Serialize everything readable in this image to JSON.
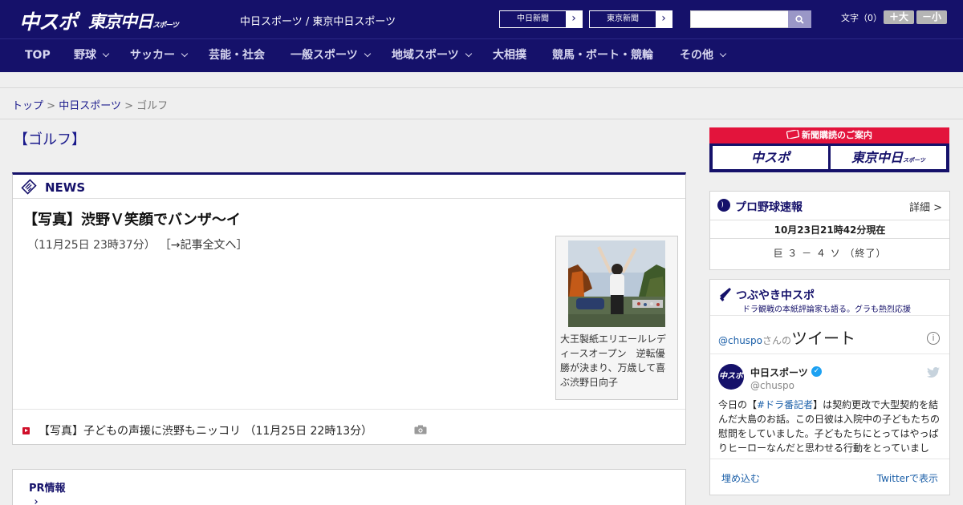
{
  "header": {
    "logo_chuspo": "中スポ",
    "logo_tokyo": "東京中日",
    "logo_tokyo_suffix": "スポーツ",
    "site_names": "中日スポーツ / 東京中日スポーツ",
    "paper_buttons": [
      "中日新聞",
      "東京新聞"
    ],
    "search_placeholder": "",
    "font_size_label": "文字（0）",
    "font_larger": "＋大",
    "font_smaller": "－小"
  },
  "nav": {
    "items": [
      {
        "label": "TOP",
        "has_dropdown": false
      },
      {
        "label": "野球",
        "has_dropdown": true
      },
      {
        "label": "サッカー",
        "has_dropdown": true
      },
      {
        "label": "芸能・社会",
        "has_dropdown": false
      },
      {
        "label": "一般スポーツ",
        "has_dropdown": true
      },
      {
        "label": "地域スポーツ",
        "has_dropdown": true
      },
      {
        "label": "大相撲",
        "has_dropdown": false
      },
      {
        "label": "競馬・ボート・競輪",
        "has_dropdown": false
      },
      {
        "label": "その他",
        "has_dropdown": true
      }
    ]
  },
  "breadcrumb": {
    "items": [
      "トップ",
      "中日スポーツ",
      "ゴルフ"
    ],
    "separator": ">"
  },
  "page": {
    "title": "【ゴルフ】"
  },
  "news": {
    "section_label": "NEWS",
    "headline": "【写真】渋野Ｖ笑顔でバンザ～イ",
    "date": "（11月25日 23時37分）",
    "full_article_link": "［→記事全文へ］",
    "photo_caption": "大王製紙エリエールレディースオープン　逆転優勝が決まり、万歳して喜ぶ渋野日向子",
    "related": "【写真】子どもの声援に渋野もニッコリ （11月25日 22時13分）"
  },
  "pr": {
    "label": "PR情報"
  },
  "sidebar": {
    "subscription_banner": {
      "title": "新聞購読のご案内",
      "left_button": "中スポ",
      "right_button": "東京中日",
      "right_button_suffix": "スポーツ"
    },
    "baseball": {
      "title": "プロ野球速報",
      "detail_link": "詳細 >",
      "updated": "10月23日21時42分現在",
      "score": "巨 ３ － ４ ソ （終了）"
    },
    "tweets": {
      "title": "つぶやき中スポ",
      "subtitle": "ドラ観戦の本紙評論家も語る。グラも熱烈応援",
      "handle": "@chuspo",
      "handle_suffix": "さんの",
      "heading": "ツイート",
      "account_name": "中日スポーツ",
      "account_user": "@chuspo",
      "avatar_text": "中スポ",
      "tweet_prefix": "今日の【",
      "tweet_hashtag": "#ドラ番記者",
      "tweet_body": "】は契約更改で大型契約を結んだ大島のお話。この日彼は入院中の子どもたちの慰問をしていました。子どもたちにとってはやっぱりヒーローなんだと思わせる行動をとっていまし",
      "embed_link": "埋め込む",
      "view_link": "Twitterで表示"
    }
  },
  "colors": {
    "brand_navy": "#15116a",
    "accent_red": "#e3143c",
    "link_blue": "#1a1a8c",
    "twitter_blue": "#1da1f2"
  }
}
